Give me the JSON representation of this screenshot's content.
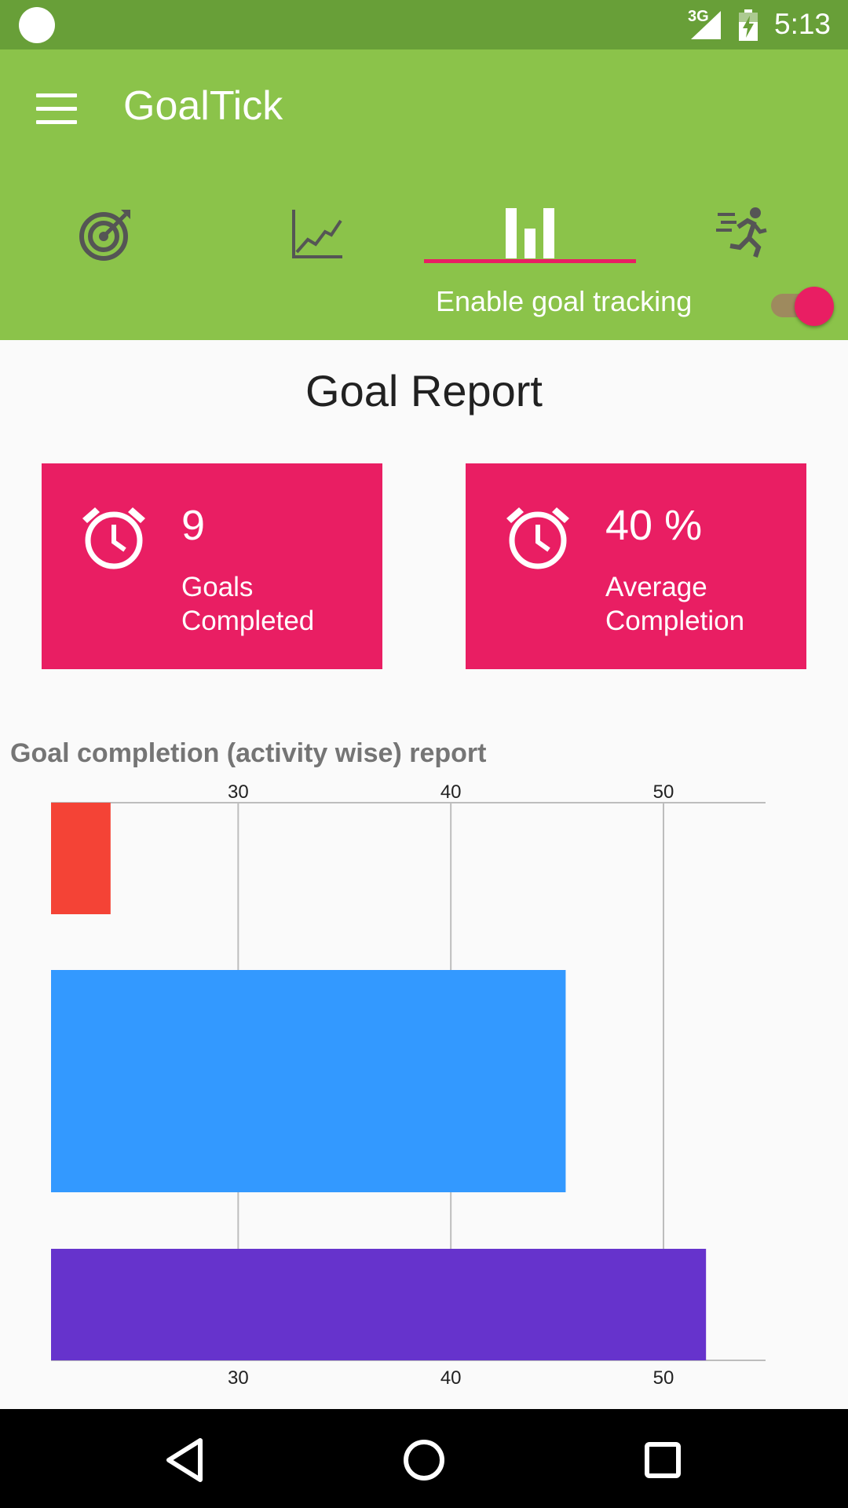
{
  "status_bar": {
    "network": "3G",
    "time": "5:13",
    "icons": [
      "circle-notification-icon",
      "signal-icon",
      "battery-icon"
    ]
  },
  "app": {
    "title": "GoalTick"
  },
  "tabs": [
    {
      "icon": "target-icon",
      "selected": false
    },
    {
      "icon": "line-chart-icon",
      "selected": false
    },
    {
      "icon": "bar-chart-icon",
      "selected": true
    },
    {
      "icon": "running-man-icon",
      "selected": false
    }
  ],
  "toggle": {
    "label": "Enable goal tracking",
    "on": true
  },
  "report": {
    "title": "Goal Report",
    "cards": [
      {
        "value": "9",
        "label": "Goals\nCompleted",
        "icon": "alarm-clock-icon"
      },
      {
        "value": "40 %",
        "label": "Average\nCompletion",
        "icon": "alarm-clock-icon"
      }
    ]
  },
  "colors": {
    "accent": "#e91e63",
    "primary": "#8bc34a",
    "primary_dark": "#689f38"
  },
  "chart_data": {
    "type": "bar",
    "orientation": "horizontal",
    "title": "Goal completion (activity wise) report",
    "xlim": [
      21.2,
      54.8
    ],
    "ticks": [
      30,
      40,
      50
    ],
    "tick_labels_top": [
      "30",
      "40",
      "50"
    ],
    "tick_labels_bottom": [
      "30",
      "40",
      "50"
    ],
    "grid": true,
    "values": [
      24,
      45.4,
      52
    ],
    "colors": [
      "#f44336",
      "#3399ff",
      "#6633cc"
    ]
  },
  "nav": {
    "icons": [
      "back-icon",
      "home-icon",
      "recents-icon"
    ]
  }
}
